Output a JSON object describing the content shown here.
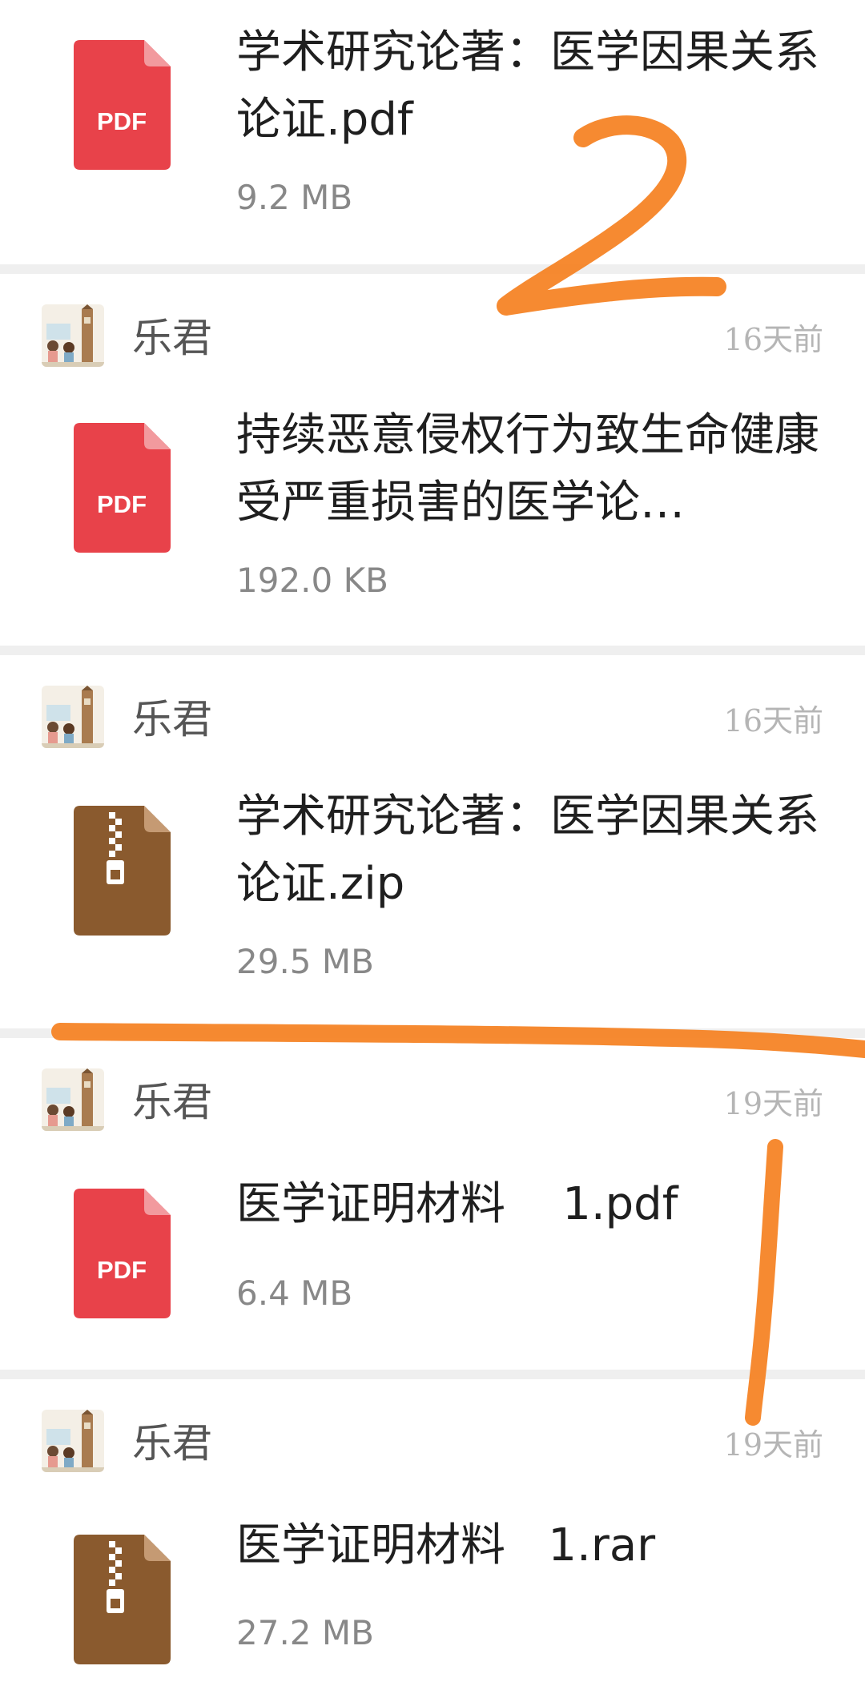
{
  "messages": [
    {
      "file_type": "pdf",
      "icon_label": "PDF",
      "file_name": "学术研究论著：医学因果关系论证.pdf",
      "file_size": "9.2 MB"
    },
    {
      "sender": "乐君",
      "time": "16天前",
      "file_type": "pdf",
      "icon_label": "PDF",
      "file_name": "持续恶意侵权行为致生命健康受严重损害的医学论…",
      "file_size": "192.0 KB"
    },
    {
      "sender": "乐君",
      "time": "16天前",
      "file_type": "zip",
      "file_name": "学术研究论著：医学因果关系论证.zip",
      "file_size": "29.5 MB"
    },
    {
      "sender": "乐君",
      "time": "19天前",
      "file_type": "pdf",
      "icon_label": "PDF",
      "file_name": "医学证明材料    1.pdf",
      "file_size": "6.4 MB"
    },
    {
      "sender": "乐君",
      "time": "19天前",
      "file_type": "rar",
      "file_name": "医学证明材料   1.rar",
      "file_size": "27.2 MB"
    }
  ],
  "annotations": {
    "number_2": "2",
    "number_1": "1"
  },
  "colors": {
    "pdf_icon": "#e8424a",
    "archive_icon": "#8a5a2e",
    "annotation": "#f5801f",
    "separator": "#efefef"
  }
}
